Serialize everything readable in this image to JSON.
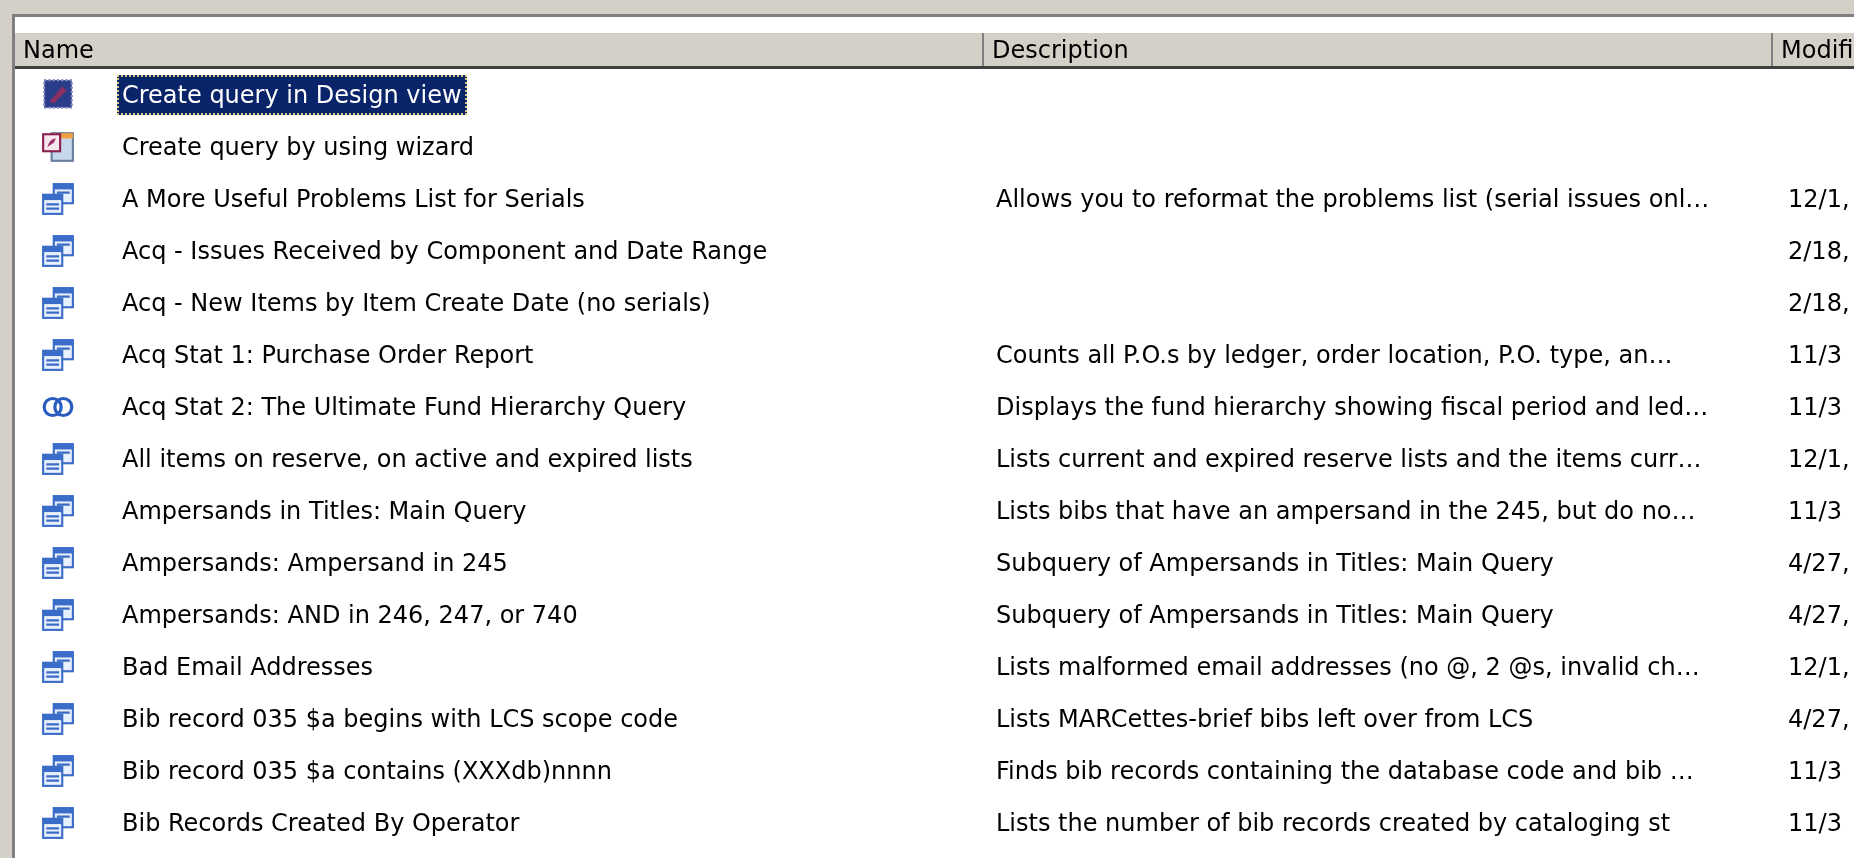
{
  "table": {
    "columns": [
      {
        "label": "Name"
      },
      {
        "label": "Description"
      },
      {
        "label": "Modifi"
      }
    ],
    "rows": [
      {
        "kind": "design",
        "name": "Create query in Design view",
        "selected": true
      },
      {
        "kind": "wizard",
        "name": "Create query by using wizard",
        "selected": false
      },
      {
        "kind": "query",
        "name": "A More Useful Problems List for Serials",
        "description": "Allows you to reformat the problems list (serial issues onl…",
        "modified": "12/1,",
        "selected": false
      },
      {
        "kind": "query",
        "name": "Acq - Issues Received by Component and Date Range",
        "modified": "2/18,",
        "selected": false
      },
      {
        "kind": "query",
        "name": "Acq - New Items by Item Create Date (no serials)",
        "modified": "2/18,",
        "selected": false
      },
      {
        "kind": "query",
        "name": "Acq Stat 1: Purchase Order Report",
        "description": "Counts all P.O.s by ledger, order location, P.O. type, an…",
        "modified": "11/3",
        "selected": false
      },
      {
        "kind": "union",
        "name": "Acq Stat 2: The Ultimate Fund Hierarchy Query",
        "description": "Displays the fund hierarchy showing fiscal period and led…",
        "modified": "11/3",
        "selected": false
      },
      {
        "kind": "query",
        "name": "All items on reserve, on active and expired lists",
        "description": "Lists current and expired reserve lists and the items curr…",
        "modified": "12/1,",
        "selected": false
      },
      {
        "kind": "query",
        "name": "Ampersands in Titles: Main Query",
        "description": "Lists bibs that have an ampersand in the 245, but do no…",
        "modified": "11/3",
        "selected": false
      },
      {
        "kind": "query",
        "name": "Ampersands: Ampersand in 245",
        "description": "Subquery of Ampersands in Titles: Main Query",
        "modified": "4/27,",
        "selected": false
      },
      {
        "kind": "query",
        "name": "Ampersands: AND in 246, 247, or 740",
        "description": "Subquery of Ampersands in Titles: Main Query",
        "modified": "4/27,",
        "selected": false
      },
      {
        "kind": "query",
        "name": "Bad Email Addresses",
        "description": "Lists malformed email addresses (no @, 2 @s, invalid ch…",
        "modified": "12/1,",
        "selected": false
      },
      {
        "kind": "query",
        "name": "Bib record 035 $a begins with LCS scope code",
        "description": "Lists MARCettes-brief bibs left over from LCS",
        "modified": "4/27,",
        "selected": false
      },
      {
        "kind": "query",
        "name": "Bib record 035 $a contains (XXXdb)nnnn",
        "description": "Finds bib records containing the database code and  bib …",
        "modified": "11/3",
        "selected": false
      },
      {
        "kind": "query",
        "name": "Bib Records Created By Operator",
        "description": "Lists the number of bib records created by cataloging st",
        "modified": "11/3",
        "selected": false
      }
    ]
  }
}
